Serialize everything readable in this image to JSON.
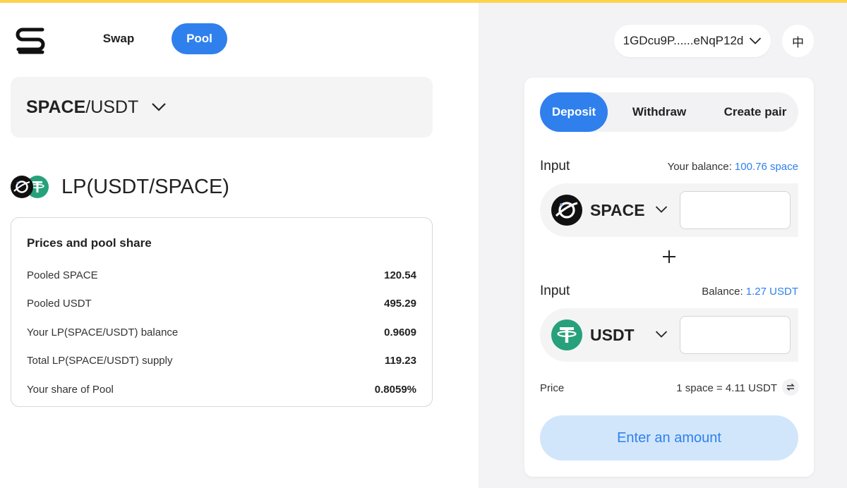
{
  "nav": {
    "swap": "Swap",
    "pool": "Pool"
  },
  "pair": {
    "base": "SPACE",
    "quote": "/USDT"
  },
  "lp": {
    "title": "LP(USDT/SPACE)"
  },
  "pool_share": {
    "heading": "Prices and pool share",
    "rows": [
      {
        "label": "Pooled SPACE",
        "value": "120.54"
      },
      {
        "label": "Pooled USDT",
        "value": "495.29"
      },
      {
        "label": "Your LP(SPACE/USDT) balance",
        "value": "0.9609"
      },
      {
        "label": "Total LP(SPACE/USDT) supply",
        "value": "119.23"
      },
      {
        "label": "Your share of Pool",
        "value": "0.8059%"
      }
    ]
  },
  "account": {
    "address": "1GDcu9P......eNqP12d",
    "language": "中"
  },
  "tabs": {
    "deposit": "Deposit",
    "withdraw": "Withdraw",
    "create": "Create pair"
  },
  "input1": {
    "label": "Input",
    "balance_label": "Your balance: ",
    "balance_value": "100.76 space",
    "token": "SPACE",
    "value": ""
  },
  "input2": {
    "label": "Input",
    "balance_label": "Balance: ",
    "balance_value": "1.27 USDT",
    "token": "USDT",
    "value": ""
  },
  "price": {
    "label": "Price",
    "value": "1 space = 4.11 USDT"
  },
  "action": {
    "label": "Enter an amount"
  },
  "colors": {
    "accent": "#2f80ed",
    "topbar": "#fcd34d",
    "usdt": "#26a17b"
  }
}
